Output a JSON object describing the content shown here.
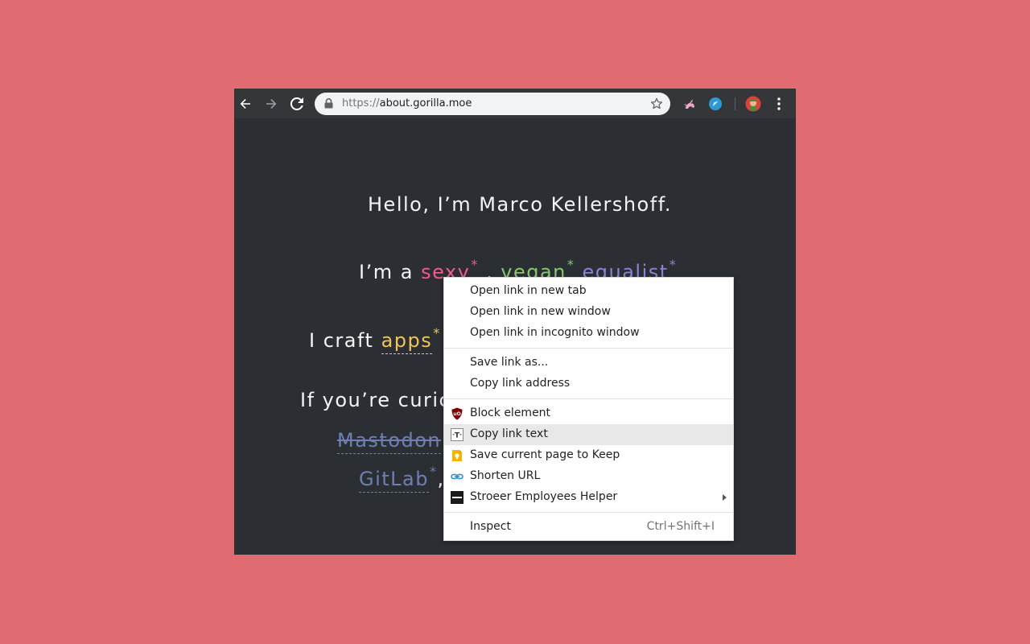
{
  "browser": {
    "url_scheme": "https://",
    "url_host": "about.gorilla.moe"
  },
  "page": {
    "greeting": "Hello, I’m Marco Kellershoff.",
    "im_a": "I’m a",
    "trait_sexy": "sexy",
    "trait_vegan": "vegan",
    "trait_equalist": "equalist",
    "craft_prefix": "I craft",
    "craft_word": "apps",
    "curious_prefix": "If you’re curic",
    "mastodon": "Mastodon",
    "gitlab": "GitLab",
    "asterisk": "*",
    "comma": ","
  },
  "context_menu": {
    "items": [
      {
        "label": "Open link in new tab"
      },
      {
        "label": "Open link in new window"
      },
      {
        "label": "Open link in incognito window"
      },
      {
        "label": "Save link as..."
      },
      {
        "label": "Copy link address"
      },
      {
        "label": "Block element",
        "icon": "ublock-icon"
      },
      {
        "label": "Copy link text",
        "icon": "copy-text-icon"
      },
      {
        "label": "Save current page to Keep",
        "icon": "keep-icon"
      },
      {
        "label": "Shorten URL",
        "icon": "link-icon"
      },
      {
        "label": "Stroeer Employees Helper",
        "icon": "stroeer-icon"
      },
      {
        "label": "Inspect",
        "shortcut": "Ctrl+Shift+I"
      }
    ]
  },
  "colors": {
    "background": "#e06b71",
    "page_bg": "#2b2f33",
    "toolbar_bg": "#35363a"
  }
}
